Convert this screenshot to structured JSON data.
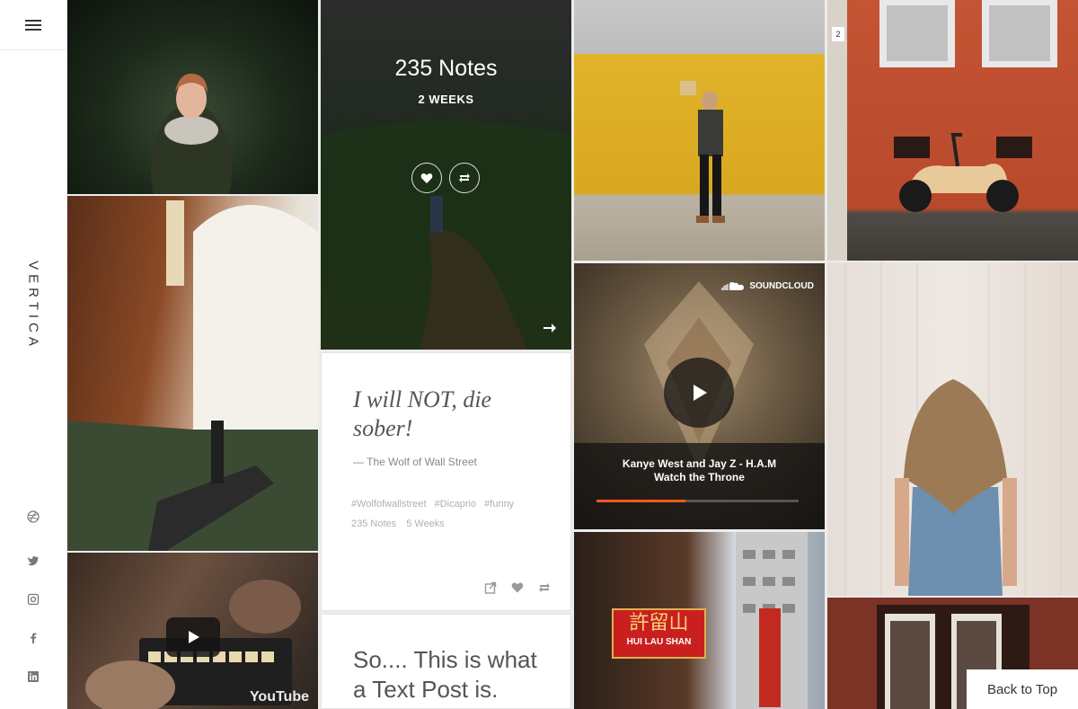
{
  "sidebar": {
    "logo": "VERTICA",
    "social": [
      {
        "name": "dribbble"
      },
      {
        "name": "twitter"
      },
      {
        "name": "instagram"
      },
      {
        "name": "facebook"
      },
      {
        "name": "linkedin"
      }
    ]
  },
  "notes_tile": {
    "title": "235 Notes",
    "subtitle": "2 WEEKS"
  },
  "quote_tile": {
    "quote": "I will NOT, die sober!",
    "source": "— The Wolf of Wall Street",
    "tags": [
      "#Wolfofwallstreet",
      "#Dicaprio",
      "#funny"
    ],
    "notes": "235 Notes",
    "age": "5 Weeks"
  },
  "text_tile": {
    "text": "So.... This is what a Text Post is."
  },
  "soundcloud_tile": {
    "brand": "SOUNDCLOUD",
    "title_line1": "Kanye West and Jay Z - H.A.M",
    "title_line2": "Watch the Throne",
    "progress": 0.44,
    "accent": "#f05a1d"
  },
  "video_tile": {
    "brand": "YouTube"
  },
  "hk_tile": {
    "sign_cn": "許留山",
    "sign_en": "HUI LAU SHAN"
  },
  "back_to_top": "Back to Top"
}
